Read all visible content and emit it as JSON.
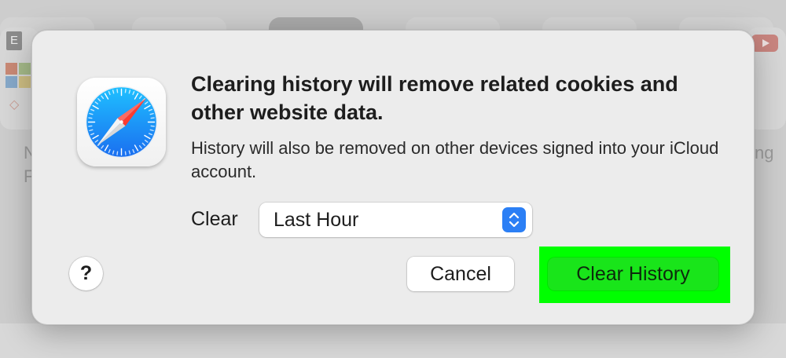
{
  "background": {
    "favicon_letter": "E",
    "snippet_left_1": "N",
    "snippet_left_2": "F",
    "snippet_right": "ng"
  },
  "dialog": {
    "title": "Clearing history will remove related cookies and other website data.",
    "message": "History will also be removed on other devices signed into your iCloud account.",
    "clear_label": "Clear",
    "range_select": {
      "selected": "Last Hour"
    },
    "help_label": "?",
    "cancel_label": "Cancel",
    "confirm_label": "Clear History",
    "colors": {
      "accent_blue": "#2b7ff5",
      "highlight_green": "#00ff00",
      "confirm_button": "#19e51a"
    }
  }
}
